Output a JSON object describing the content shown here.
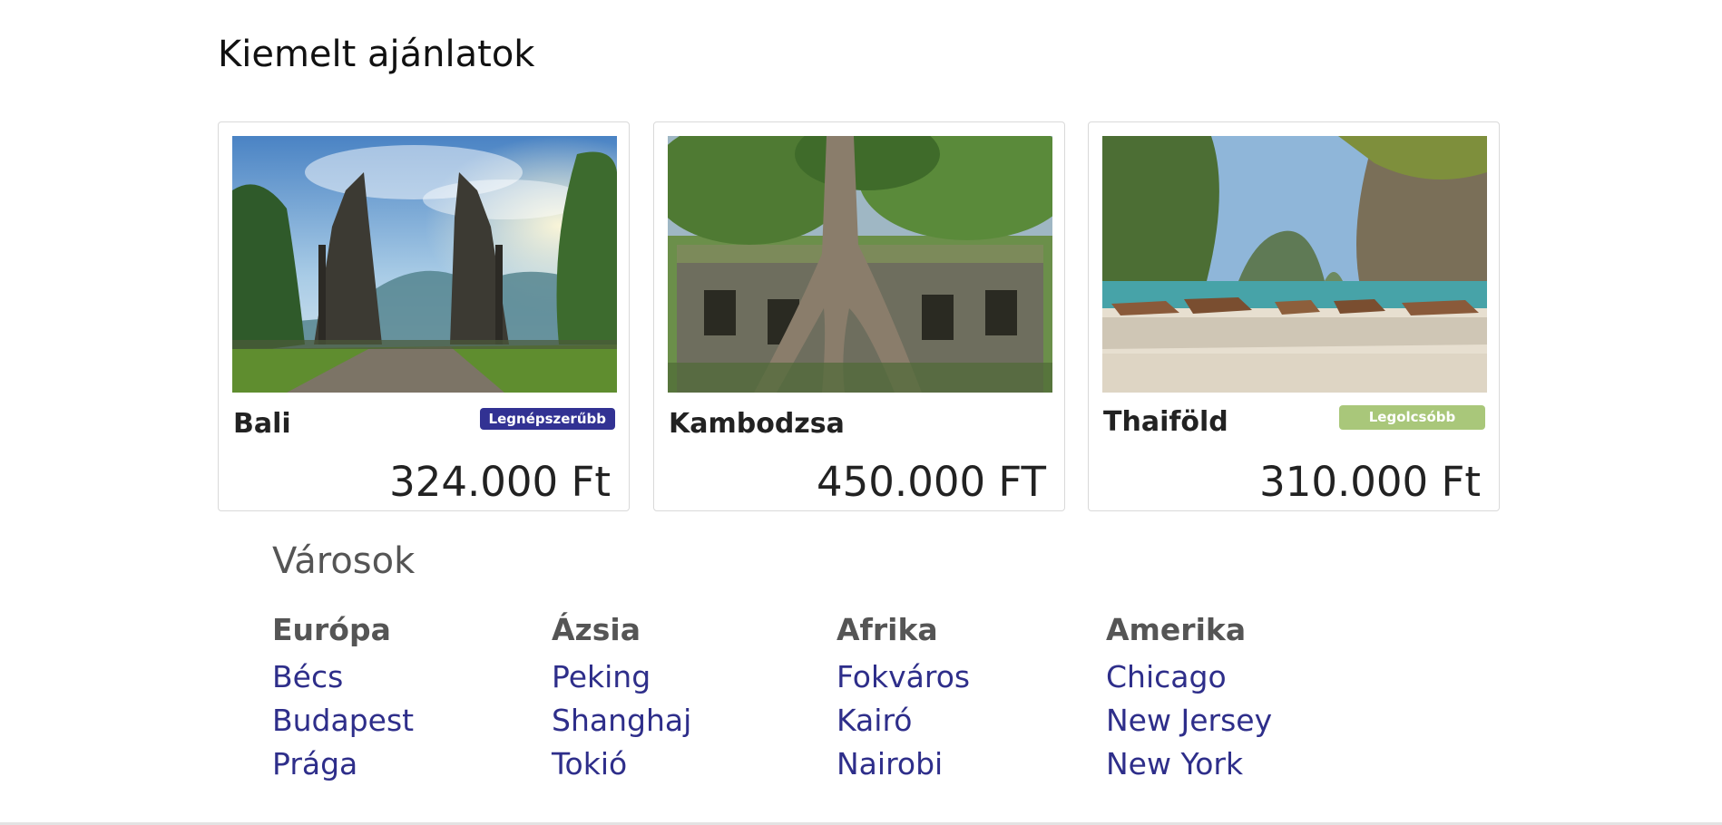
{
  "featured": {
    "title": "Kiemelt ajánlatok",
    "offers": [
      {
        "name": "Bali",
        "price": "324.000 Ft",
        "badge": "Legnépszerűbb",
        "badge_color": "#323293",
        "image": "bali-temple-gate-photo"
      },
      {
        "name": "Kambodzsa",
        "price": "450.000 FT",
        "badge": "",
        "image": "cambodia-temple-tree-roots-photo"
      },
      {
        "name": "Thaiföld",
        "price": "310.000 Ft",
        "badge": "Legolcsóbb",
        "badge_color": "#a9c77a",
        "image": "thailand-beach-longtail-boats-photo"
      }
    ]
  },
  "cities": {
    "title": "Városok",
    "regions": [
      {
        "name": "Európa",
        "cities": [
          "Bécs",
          "Budapest",
          "Prága"
        ]
      },
      {
        "name": "Ázsia",
        "cities": [
          "Peking",
          "Shanghaj",
          "Tokió"
        ]
      },
      {
        "name": "Afrika",
        "cities": [
          "Fokváros",
          "Kairó",
          "Nairobi"
        ]
      },
      {
        "name": "Amerika",
        "cities": [
          "Chicago",
          "New Jersey",
          "New York"
        ]
      }
    ]
  },
  "colors": {
    "link": "#2e2e8a",
    "heading_gray": "#555555"
  }
}
